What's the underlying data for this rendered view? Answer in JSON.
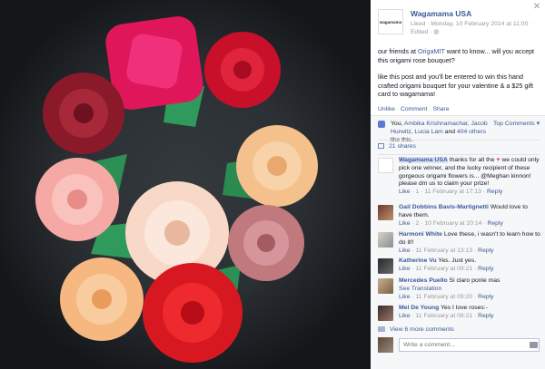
{
  "post": {
    "page_name": "Wagamama USA",
    "page_logo_text": "wagamama",
    "meta": "Liked · Monday, 10 February 2014 at 11:00 · Edited · ",
    "text_p1_a": "our friends at ",
    "text_p1_link": "OrigaMIT",
    "text_p1_b": " want to know... will you accept this origami rose bouquet?",
    "text_p2": "like this post and you'll be entered to win this hand crafted origami bouquet for your valentine & a $25 gift card to wagamama!",
    "actions": {
      "unlike": "Unlike",
      "comment": "Comment",
      "share": "Share",
      "sep": " · "
    }
  },
  "ufi": {
    "likes_prefix": "You, ",
    "likes_names": "Ambika Krishnamachar, Jacob Hurwitz, Lucia Lam",
    "likes_and": " and ",
    "likes_others": "404 others",
    "likes_suffix": " like this.",
    "top_comments": "Top Comments ▾",
    "shares": "21 shares",
    "view_more": "View 6 more comments",
    "write_placeholder": "Write a comment..."
  },
  "comments": [
    {
      "author": "Wagamama USA",
      "text_a": " thanks for all the ",
      "heart": "♥",
      "text_b": " we could only pick one winner, and the lucky recipient of these gorgeous origami flowers is... @Meghan kinnon! please dm us to claim your prize!",
      "like": "Like",
      "reply": "Reply",
      "meta": "1 · 11 February at 17:13"
    },
    {
      "author": "Gail Dobbins Bavis-Martignetti",
      "text": " Would love to have them.",
      "like": "Like",
      "reply": "Reply",
      "meta": "2 · 10 February at 20:14"
    },
    {
      "author": "Harmoni White",
      "text": " Love these, i wasn't to learn how to do it!!",
      "like": "Like",
      "reply": "Reply",
      "meta": "11 February at 13:13"
    },
    {
      "author": "Katherine Vu",
      "text": " Yes. Just yes.",
      "like": "Like",
      "reply": "Reply",
      "meta": "11 February at 09:21"
    },
    {
      "author": "Mercedes Puello",
      "text": " Si claro ponle mas",
      "see_translation": "See Translation",
      "like": "Like",
      "reply": "Reply",
      "meta": "11 February at 09:20"
    },
    {
      "author": "Mel De Young",
      "text": " Yes I love roses:-",
      "like": "Like",
      "reply": "Reply",
      "meta": "11 February at 08:21"
    }
  ],
  "close_glyph": "✕",
  "colors": {
    "link": "#3b5998",
    "meta": "#999999",
    "highlight": "#dbe3f3"
  }
}
